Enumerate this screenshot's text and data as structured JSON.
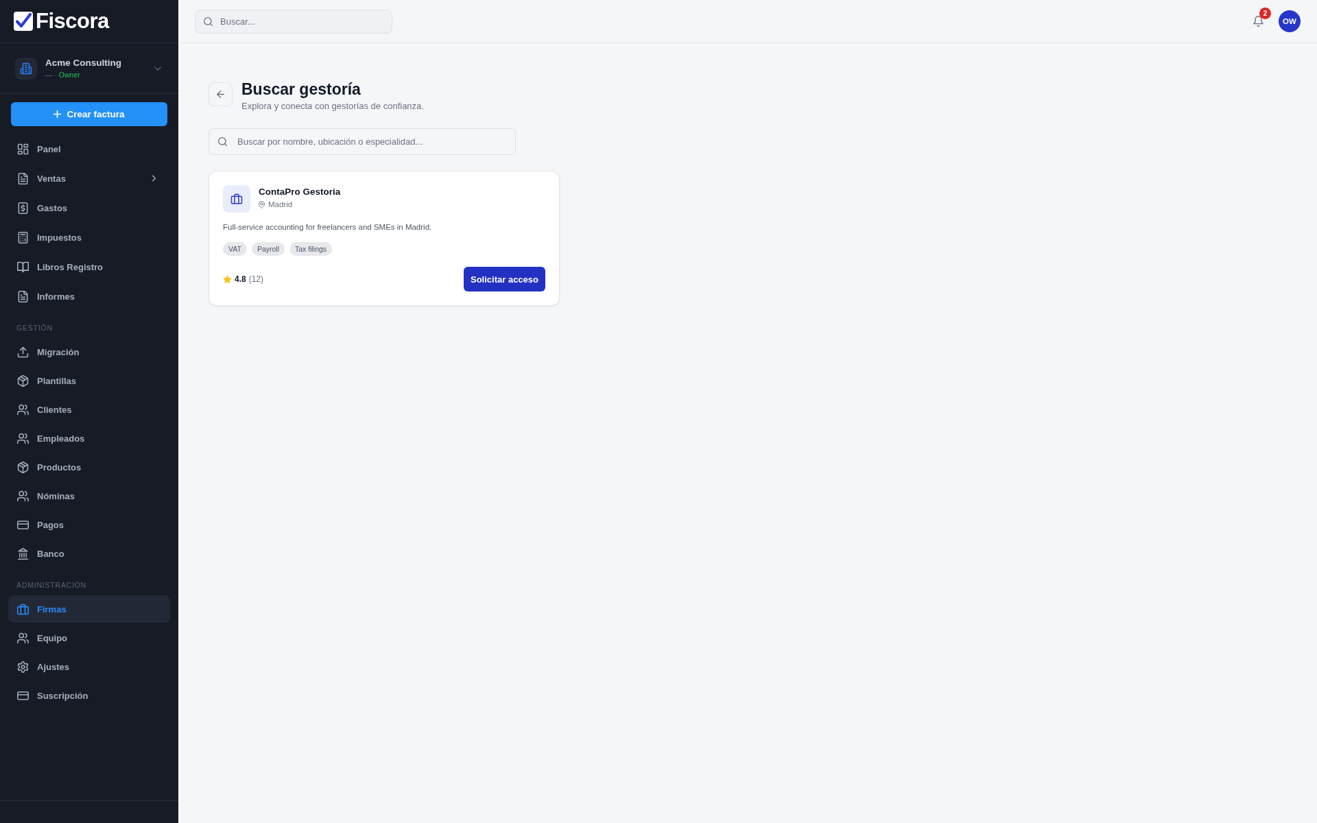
{
  "sidebar": {
    "brand": "Fiscora",
    "workspace": {
      "name": "Acme Consulting",
      "detail": "—",
      "separator": "·",
      "role": "Owner"
    },
    "create_button": "Crear factura",
    "sections": [
      {
        "items": [
          {
            "label": "Panel",
            "selected": false,
            "expandable": false
          },
          {
            "label": "Ventas",
            "selected": false,
            "expandable": true
          },
          {
            "label": "Gastos",
            "selected": false,
            "expandable": false
          },
          {
            "label": "Impuestos",
            "selected": false,
            "expandable": false
          },
          {
            "label": "Libros Registro",
            "selected": false,
            "expandable": false
          },
          {
            "label": "Informes",
            "selected": false,
            "expandable": false
          }
        ]
      },
      {
        "heading": "GESTIÓN",
        "items": [
          {
            "label": "Migración",
            "selected": false,
            "expandable": false
          },
          {
            "label": "Plantillas",
            "selected": false,
            "expandable": false
          },
          {
            "label": "Clientes",
            "selected": false,
            "expandable": false
          },
          {
            "label": "Empleados",
            "selected": false,
            "expandable": false
          },
          {
            "label": "Productos",
            "selected": false,
            "expandable": false
          },
          {
            "label": "Nóminas",
            "selected": false,
            "expandable": false
          },
          {
            "label": "Pagos",
            "selected": false,
            "expandable": false
          },
          {
            "label": "Banco",
            "selected": false,
            "expandable": false
          }
        ]
      },
      {
        "heading": "ADMINISTRACIÓN",
        "items": [
          {
            "label": "Firmas",
            "selected": true,
            "expandable": false
          },
          {
            "label": "Equipo",
            "selected": false,
            "expandable": false
          },
          {
            "label": "Ajustes",
            "selected": false,
            "expandable": false
          },
          {
            "label": "Suscripción",
            "selected": false,
            "expandable": false
          }
        ]
      }
    ]
  },
  "topbar": {
    "search": {
      "placeholder": "Buscar..."
    },
    "notifications": {
      "count": "2"
    },
    "avatar": {
      "initials": "OW"
    }
  },
  "page": {
    "title": "Buscar gestoría",
    "subtitle": "Explora y conecta con gestorías de confianza.",
    "search": {
      "placeholder": "Buscar por nombre, ubicación o especialidad..."
    },
    "firms": [
      {
        "name": "ContaPro Gestoria",
        "location": "Madrid",
        "description": "Full-service accounting for freelancers and SMEs in Madrid.",
        "tags": [
          "VAT",
          "Payroll",
          "Tax filings"
        ],
        "rating": "4.8",
        "reviews": "(12)",
        "action": "Solicitar acceso"
      }
    ]
  }
}
